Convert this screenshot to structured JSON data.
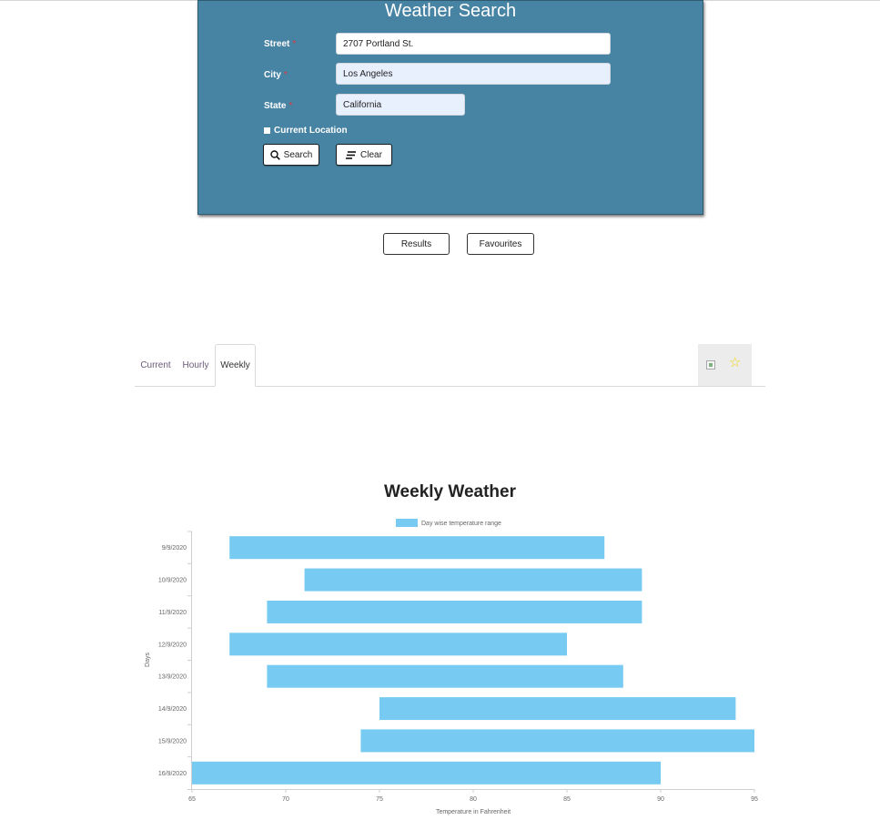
{
  "search": {
    "title": "Weather Search",
    "street_label": "Street",
    "street_value": "2707 Portland St.",
    "city_label": "City",
    "city_value": "Los Angeles",
    "state_label": "State",
    "state_value": "California",
    "required_marker": "*",
    "current_location_label": "Current Location",
    "current_location_checked": false,
    "search_button": "Search",
    "clear_button": "Clear"
  },
  "results_nav": {
    "results_button": "Results",
    "favourites_button": "Favourites"
  },
  "tabs": [
    {
      "label": "Current",
      "active": false
    },
    {
      "label": "Hourly",
      "active": false
    },
    {
      "label": "Weekly",
      "active": true
    }
  ],
  "actions": {
    "image_icon": "broken-image-icon",
    "favourite_icon": "star-outline-icon",
    "favourite_glyph": "☆"
  },
  "colors": {
    "panel": "#4783a3",
    "bar": "#77cbf2",
    "star": "#f2d400"
  },
  "chart_data": {
    "type": "bar",
    "orientation": "horizontal-floating",
    "title": "Weekly Weather",
    "xlabel": "Temperature in Fahrenheit",
    "ylabel": "Days",
    "legend": "Day wise temperature range",
    "legend_position": "top",
    "xlim": [
      65,
      95
    ],
    "x_ticks": [
      "65",
      "70",
      "75",
      "80",
      "85",
      "90",
      "95"
    ],
    "grid": false,
    "categories": [
      "9/9/2020",
      "10/9/2020",
      "11/9/2020",
      "12/9/2020",
      "13/9/2020",
      "14/9/2020",
      "15/9/2020",
      "16/9/2020"
    ],
    "ranges": [
      [
        67,
        87
      ],
      [
        71,
        89
      ],
      [
        69,
        89
      ],
      [
        67,
        85
      ],
      [
        69,
        88
      ],
      [
        75,
        94
      ],
      [
        74,
        95
      ],
      [
        65,
        90
      ]
    ]
  }
}
